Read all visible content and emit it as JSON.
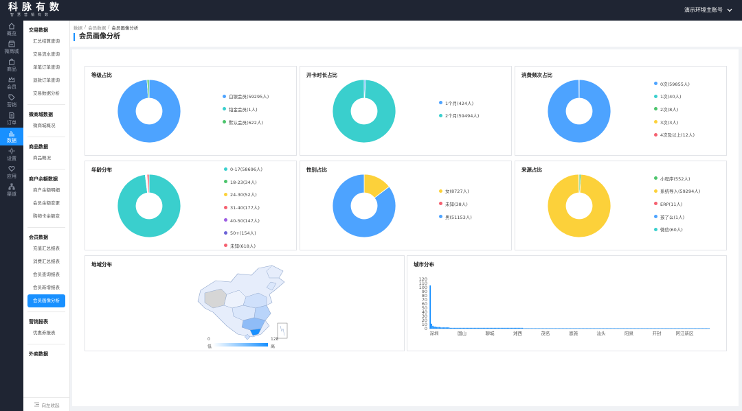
{
  "logo": {
    "title": "科脉有数",
    "subtitle": "智慧营销有数"
  },
  "account": {
    "label": "演示环境主账号"
  },
  "rail": [
    {
      "label": "概览",
      "icon": "home-icon"
    },
    {
      "label": "微商城",
      "icon": "store-icon"
    },
    {
      "label": "商品",
      "icon": "bag-icon"
    },
    {
      "label": "会员",
      "icon": "crown-icon"
    },
    {
      "label": "营销",
      "icon": "tag-icon"
    },
    {
      "label": "订单",
      "icon": "doc-icon"
    },
    {
      "label": "数据",
      "icon": "chart-icon"
    },
    {
      "label": "设置",
      "icon": "gear-icon"
    },
    {
      "label": "应用",
      "icon": "heart-icon"
    },
    {
      "label": "渠道",
      "icon": "network-icon"
    }
  ],
  "subnav": [
    {
      "title": "交易数据",
      "items": [
        "汇总结算查询",
        "交易流水查询",
        "单笔订单查询",
        "退款订单查询",
        "交易数据分析"
      ]
    },
    {
      "title": "微商城数据",
      "items": [
        "微商城概况"
      ]
    },
    {
      "title": "商品数据",
      "items": [
        "商品概况"
      ]
    },
    {
      "title": "商户余额数据",
      "items": [
        "商户余额明细",
        "会员余额变更",
        "购物卡余额变"
      ]
    },
    {
      "title": "会员数据",
      "items": [
        "充值汇总报表",
        "消费汇总报表",
        "会员查询报表",
        "会员新增报表",
        "会员画像分析"
      ]
    },
    {
      "title": "营销报表",
      "items": [
        "优惠券报表"
      ]
    },
    {
      "title": "外卖数据",
      "items": []
    }
  ],
  "collapse_label": "向左收起",
  "breadcrumb": [
    "数据",
    "会员数据",
    "会员画像分析"
  ],
  "page_title": "会员画像分析",
  "colors": {
    "blue": "#4da3ff",
    "teal": "#3acfcd",
    "green": "#4cc46c",
    "yellow": "#fcd13a",
    "red": "#f56070",
    "purple": "#9c5de2",
    "indigo": "#6b62d6",
    "accent": "#1890ff",
    "nav": "#1f2533"
  },
  "chart_data": [
    {
      "type": "pie",
      "title": "等级占比",
      "labels": [
        "白银会员(59295人)",
        "铂金会员(1人)",
        "默认会员(622人)"
      ],
      "values": [
        59295,
        1,
        622
      ],
      "colors": [
        "#4da3ff",
        "#3acfcd",
        "#4cc46c"
      ]
    },
    {
      "type": "pie",
      "title": "开卡时长占比",
      "labels": [
        "1个月(424人)",
        "2个月(59494人)"
      ],
      "values": [
        424,
        59494
      ],
      "colors": [
        "#4da3ff",
        "#3acfcd"
      ]
    },
    {
      "type": "pie",
      "title": "消费频次占比",
      "labels": [
        "0次(59855人)",
        "1次(40人)",
        "2次(8人)",
        "3次(3人)",
        "4次及以上(12人)"
      ],
      "values": [
        59855,
        40,
        8,
        3,
        12
      ],
      "colors": [
        "#4da3ff",
        "#3acfcd",
        "#4cc46c",
        "#fcd13a",
        "#f56070"
      ]
    },
    {
      "type": "pie",
      "title": "年龄分布",
      "labels": [
        "0-17(58696人)",
        "18-23(34人)",
        "24-30(52人)",
        "31-40(177人)",
        "40-50(147人)",
        "50+(154人)",
        "未知(618人)"
      ],
      "values": [
        58696,
        34,
        52,
        177,
        147,
        154,
        618
      ],
      "colors": [
        "#3acfcd",
        "#4cc46c",
        "#fcd13a",
        "#f56070",
        "#9c5de2",
        "#6b62d6",
        "#f56070"
      ]
    },
    {
      "type": "pie",
      "title": "性别占比",
      "labels": [
        "女(8727人)",
        "未知(38人)",
        "男(51153人)"
      ],
      "values": [
        8727,
        38,
        51153
      ],
      "colors": [
        "#fcd13a",
        "#f56070",
        "#4da3ff"
      ]
    },
    {
      "type": "pie",
      "title": "来源占比",
      "labels": [
        "小程序(552人)",
        "系统导入(59294人)",
        "ERP(11人)",
        "孩了么(1人)",
        "微信(60人)"
      ],
      "values": [
        552,
        59294,
        11,
        1,
        60
      ],
      "colors": [
        "#4cc46c",
        "#fcd13a",
        "#f56070",
        "#4da3ff",
        "#3acfcd"
      ]
    },
    {
      "type": "heatmap",
      "title": "地域分布",
      "scale_min": "0",
      "scale_max": "128",
      "low_label": "低",
      "high_label": "高"
    },
    {
      "type": "bar",
      "title": "城市分布",
      "ylim": [
        0,
        120
      ],
      "yticks": [
        0,
        10,
        20,
        30,
        40,
        50,
        60,
        70,
        80,
        90,
        100,
        110,
        120
      ],
      "xlabels": [
        "深圳",
        "国山",
        "聊城",
        "湘西",
        "茂名",
        "恩施",
        "汕头",
        "阳泉",
        "开封",
        "阿江新区"
      ],
      "values": [
        105,
        12,
        7,
        5,
        5,
        4,
        4,
        4,
        3,
        3,
        3,
        3,
        3,
        3,
        3,
        2,
        2,
        2,
        2,
        2,
        2,
        2,
        2,
        2,
        2,
        2,
        2,
        2,
        2,
        2,
        2,
        2,
        2,
        2,
        2,
        2,
        2,
        2,
        2,
        2,
        2,
        2,
        2,
        2,
        2,
        2,
        2,
        2,
        2,
        2,
        2,
        2,
        2,
        2,
        2,
        2,
        2,
        2,
        2,
        2,
        2,
        2,
        2,
        2,
        2,
        2,
        2,
        2,
        2,
        2,
        1,
        1,
        1,
        1,
        1,
        1,
        1,
        1,
        1,
        1,
        1,
        1,
        1,
        1,
        1,
        1,
        1,
        1,
        1,
        1,
        1,
        1,
        1,
        1,
        1,
        1,
        1,
        1,
        1,
        1,
        1,
        1,
        1,
        1,
        1,
        1,
        1,
        1,
        1,
        1,
        1,
        1,
        1,
        1,
        1,
        1,
        1,
        1,
        1,
        1,
        1,
        1,
        1,
        1,
        1,
        1,
        1,
        1,
        1,
        1,
        1,
        1,
        1,
        1,
        1,
        1,
        1,
        1,
        1,
        1,
        1,
        1,
        1,
        1,
        1,
        1,
        1,
        1,
        1,
        1,
        1,
        1,
        1,
        1,
        1,
        1,
        1,
        1,
        1,
        1,
        1,
        1,
        1,
        1,
        1,
        1,
        1,
        1,
        1,
        1,
        1,
        1,
        1,
        1,
        1,
        1,
        1,
        1,
        1,
        1,
        1,
        1,
        1,
        1,
        1,
        1,
        1,
        1,
        1,
        1,
        1,
        1,
        1,
        1,
        1,
        1,
        1,
        1,
        1,
        1,
        1,
        1,
        1,
        1,
        1,
        1,
        1,
        1,
        1,
        1
      ]
    }
  ]
}
